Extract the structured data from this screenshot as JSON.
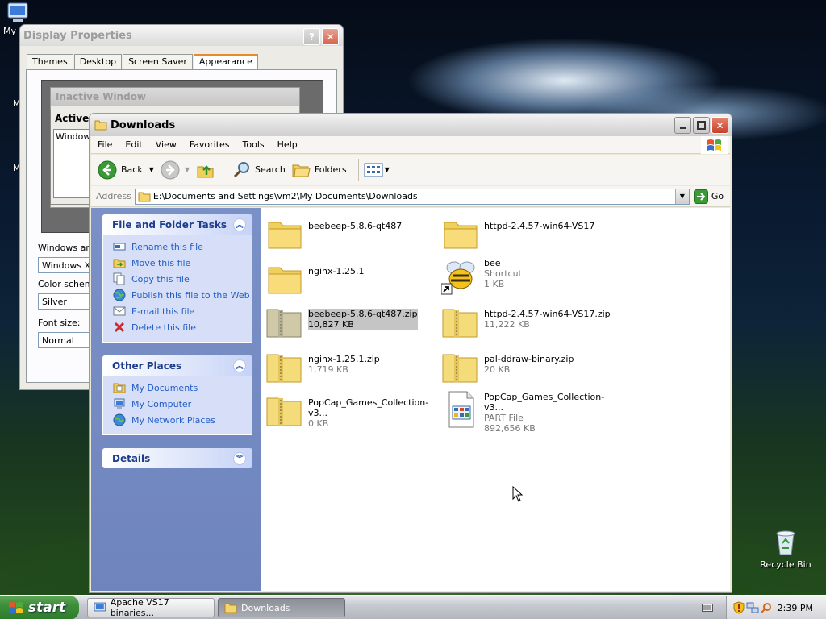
{
  "desktop": {
    "icons": {
      "my_computer_partial": "My",
      "recycle_bin": "Recycle Bin"
    },
    "left_labels": [
      "M",
      "M"
    ]
  },
  "display_properties": {
    "title": "Display Properties",
    "tabs": [
      "Themes",
      "Desktop",
      "Screen Saver",
      "Appearance"
    ],
    "active_tab": "Appearance",
    "preview": {
      "inactive_title": "Inactive Window",
      "active_title": "Active",
      "window_text": "Window"
    },
    "fields": {
      "windows_buttons_label": "Windows and",
      "windows_buttons_value": "Windows XP",
      "color_scheme_label": "Color scheme",
      "color_scheme_value": "Silver",
      "font_size_label": "Font size:",
      "font_size_value": "Normal"
    }
  },
  "explorer": {
    "title": "Downloads",
    "menu": [
      "File",
      "Edit",
      "View",
      "Favorites",
      "Tools",
      "Help"
    ],
    "toolbar": {
      "back": "Back",
      "search": "Search",
      "folders": "Folders"
    },
    "address": {
      "label": "Address",
      "value": "E:\\Documents and Settings\\vm2\\My Documents\\Downloads",
      "go": "Go"
    },
    "file_tasks": {
      "title": "File and Folder Tasks",
      "items": [
        "Rename this file",
        "Move this file",
        "Copy this file",
        "Publish this file to the Web",
        "E-mail this file",
        "Delete this file"
      ]
    },
    "other_places": {
      "title": "Other Places",
      "items": [
        "My Documents",
        "My Computer",
        "My Network Places"
      ]
    },
    "details": {
      "title": "Details"
    },
    "files": [
      {
        "name": "beebeep-5.8.6-qt487",
        "line2": "",
        "line3": "",
        "kind": "folder"
      },
      {
        "name": "httpd-2.4.57-win64-VS17",
        "line2": "",
        "line3": "",
        "kind": "folder"
      },
      {
        "name": "nginx-1.25.1",
        "line2": "",
        "line3": "",
        "kind": "folder"
      },
      {
        "name": "bee",
        "line2": "Shortcut",
        "line3": "1 KB",
        "kind": "shortcut"
      },
      {
        "name": "beebeep-5.8.6-qt487.zip",
        "line2": "10,827 KB",
        "line3": "",
        "kind": "zip"
      },
      {
        "name": "httpd-2.4.57-win64-VS17.zip",
        "line2": "11,222 KB",
        "line3": "",
        "kind": "zip"
      },
      {
        "name": "nginx-1.25.1.zip",
        "line2": "1,719 KB",
        "line3": "",
        "kind": "zip"
      },
      {
        "name": "pal-ddraw-binary.zip",
        "line2": "20 KB",
        "line3": "",
        "kind": "zip"
      },
      {
        "name": "PopCap_Games_Collection-v3...",
        "line2": "0 KB",
        "line3": "",
        "kind": "zip"
      },
      {
        "name": "PopCap_Games_Collection-v3...",
        "line2": "PART File",
        "line3": "892,656 KB",
        "kind": "part"
      }
    ]
  },
  "taskbar": {
    "start": "start",
    "tasks": [
      "Apache VS17 binaries...",
      "Downloads"
    ],
    "clock": "2:39 PM"
  }
}
